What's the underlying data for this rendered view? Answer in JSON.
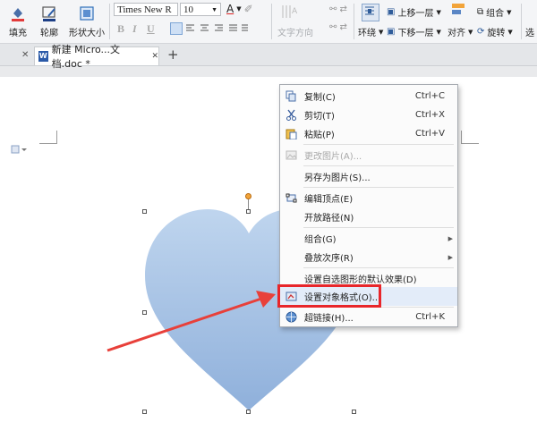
{
  "ribbon": {
    "fill_label": "填充",
    "outline_label": "轮廓",
    "shape_size_label": "形状大小",
    "font_name": "Times New R",
    "font_size": "10",
    "bold": "B",
    "italic": "I",
    "underline": "U",
    "text_direction_label": "文字方向",
    "wrap_label": "环绕",
    "bring_forward_label": "上移一层",
    "send_backward_label": "下移一层",
    "align_label": "对齐",
    "group_label": "组合",
    "rotate_label": "旋转",
    "select_label": "选"
  },
  "tabbar": {
    "doc_tab_label": "新建 Micro...文档.doc *",
    "close_glyph": "✕",
    "add_glyph": "+"
  },
  "context_menu": {
    "items": [
      {
        "label": "复制(C)",
        "shortcut": "Ctrl+C",
        "icon": "copy-icon",
        "enabled": true
      },
      {
        "label": "剪切(T)",
        "shortcut": "Ctrl+X",
        "icon": "scissors-icon",
        "enabled": true
      },
      {
        "label": "粘贴(P)",
        "shortcut": "Ctrl+V",
        "icon": "paste-icon",
        "enabled": true
      },
      {
        "label": "更改图片(A)...",
        "shortcut": "",
        "icon": "change-picture-icon",
        "enabled": false
      },
      {
        "label": "另存为图片(S)...",
        "shortcut": "",
        "icon": "",
        "enabled": true
      },
      {
        "label": "编辑顶点(E)",
        "shortcut": "",
        "icon": "edit-points-icon",
        "enabled": true
      },
      {
        "label": "开放路径(N)",
        "shortcut": "",
        "icon": "",
        "enabled": true
      },
      {
        "label": "组合(G)",
        "shortcut": "",
        "icon": "",
        "enabled": true,
        "submenu": true
      },
      {
        "label": "叠放次序(R)",
        "shortcut": "",
        "icon": "",
        "enabled": true,
        "submenu": true
      },
      {
        "label": "设置自选图形的默认效果(D)",
        "shortcut": "",
        "icon": "",
        "enabled": true
      },
      {
        "label": "设置对象格式(O)...",
        "shortcut": "",
        "icon": "format-object-icon",
        "enabled": true,
        "highlighted": true
      },
      {
        "label": "超链接(H)...",
        "shortcut": "Ctrl+K",
        "icon": "hyperlink-icon",
        "enabled": true
      }
    ]
  },
  "colors": {
    "highlight_box": "#e8262a",
    "arrow": "#e8403a",
    "heart_top": "#bcd2ec",
    "heart_bottom": "#93b3dc",
    "menu_hover": "#e3ecf9"
  }
}
